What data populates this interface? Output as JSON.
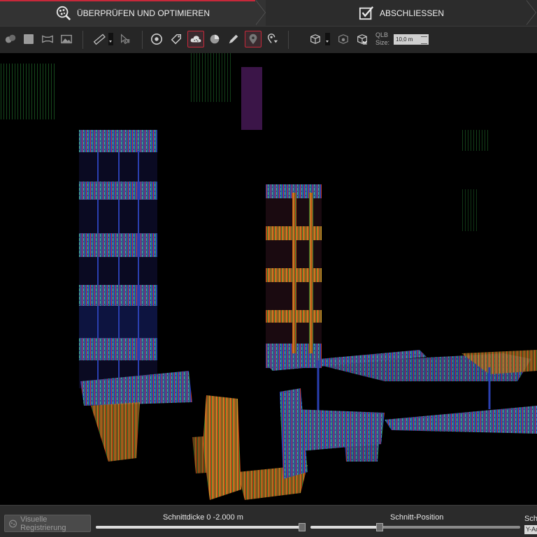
{
  "steps": {
    "review": "ÜBERPRÜFEN UND OPTIMIEREN",
    "finish": "ABSCHLIESSEN"
  },
  "toolbar": {
    "qlb_label": "QLB",
    "size_label": "Size:",
    "size_value": "10,0 m",
    "tools": [
      "layers-icon",
      "square-select-icon",
      "panorama-icon",
      "image-icon",
      "measure-icon",
      "select-arrow-icon",
      "circle-target-icon",
      "tag-icon",
      "cloud-icon",
      "pie-icon",
      "pencil-icon",
      "marker-icon",
      "add-location-icon",
      "box-view-icon",
      "box-eye-icon",
      "box-m-icon"
    ],
    "accent_color": "#c8283a"
  },
  "bottom": {
    "visual_registration": "Visuelle Registrierung",
    "section_thickness": "Schnittdicke 0 -2.000 m",
    "section_position": "Schnitt-Position",
    "section_cut_label": "Schn",
    "axis_value": "Y-Ac"
  }
}
